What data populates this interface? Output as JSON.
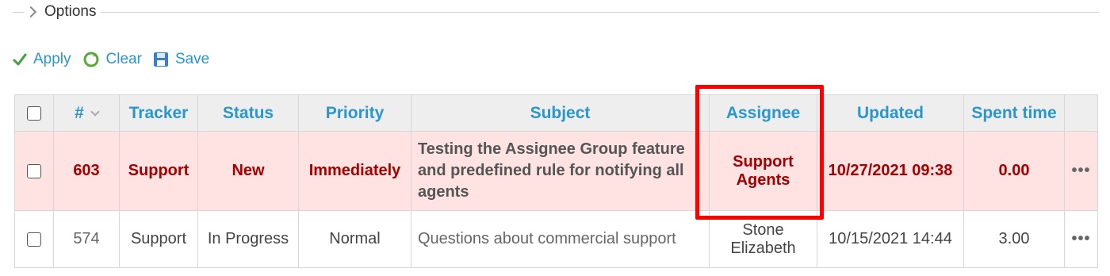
{
  "options": {
    "label": "Options"
  },
  "toolbar": {
    "apply": "Apply",
    "clear": "Clear",
    "save": "Save"
  },
  "table": {
    "headers": [
      "#",
      "Tracker",
      "Status",
      "Priority",
      "Subject",
      "Assignee",
      "Updated",
      "Spent time"
    ],
    "rows": [
      {
        "id": "603",
        "tracker": "Support",
        "status": "New",
        "priority": "Immediately",
        "subject": "Testing the Assignee Group feature and predefined rule for notifying all agents",
        "assignee": "Support Agents",
        "updated": "10/27/2021 09:38",
        "spent": "0.00",
        "menu": "•••"
      },
      {
        "id": "574",
        "tracker": "Support",
        "status": "In Progress",
        "priority": "Normal",
        "subject": "Questions about commercial support",
        "assignee": "Stone Elizabeth",
        "updated": "10/15/2021 14:44",
        "spent": "3.00",
        "menu": "•••"
      }
    ]
  },
  "colors": {
    "link": "#2996cc",
    "priority_immediate": "#a30000",
    "row_highlight": "#ffe3e3",
    "annotation": "#ff0000"
  }
}
